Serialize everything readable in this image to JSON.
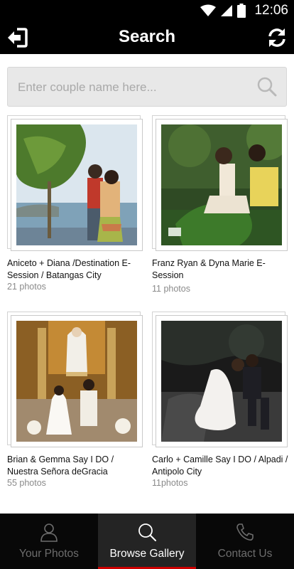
{
  "status_bar": {
    "time": "12:06"
  },
  "header": {
    "title": "Search"
  },
  "search": {
    "placeholder": "Enter couple name here..."
  },
  "albums": [
    {
      "title": "Aniceto + Diana /Destination E-Session / Batangas City",
      "count": "21 photos"
    },
    {
      "title": "Franz Ryan & Dyna Marie E-Session",
      "count": "11 photos"
    },
    {
      "title": "Brian & Gemma Say I DO / Nuestra Señora deGracia",
      "count": "55 photos"
    },
    {
      "title": "Carlo + Camille Say I DO / Alpadi / Antipolo City",
      "count": "11photos"
    }
  ],
  "bottom_nav": {
    "items": [
      {
        "label": "Your Photos",
        "icon": "person-icon"
      },
      {
        "label": "Browse Gallery",
        "icon": "search-icon",
        "active": true
      },
      {
        "label": "Contact Us",
        "icon": "phone-icon"
      }
    ]
  },
  "colors": {
    "bar": "#000000",
    "accent": "#cc0000",
    "search_bg": "#e8e8e8"
  }
}
